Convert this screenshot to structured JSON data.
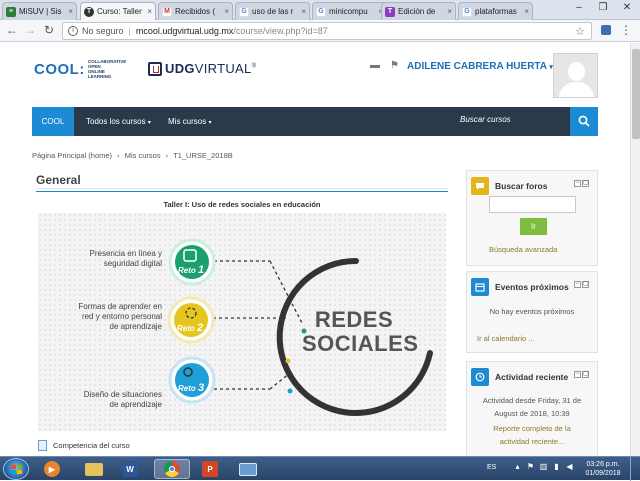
{
  "browser": {
    "tabs": [
      {
        "title": "MiSUV | Sis",
        "icon": "siiau-icon",
        "color": "#2f7a3d",
        "glyph": "≡"
      },
      {
        "title": "Curso: Taller",
        "icon": "moodle-icon",
        "color": "#333333",
        "glyph": "T",
        "active": true
      },
      {
        "title": "Recibidos (",
        "icon": "gmail-icon",
        "color": "#d93025",
        "glyph": "M"
      },
      {
        "title": "uso de las r",
        "icon": "google-icon",
        "color": "#4285f4",
        "glyph": "G"
      },
      {
        "title": "minicompu",
        "icon": "google-icon",
        "color": "#4285f4",
        "glyph": "G"
      },
      {
        "title": "Edición de",
        "icon": "tab-t-icon",
        "color": "#8b3fbd",
        "glyph": "T"
      },
      {
        "title": "plataformas",
        "icon": "google-icon",
        "color": "#4285f4",
        "glyph": "G"
      }
    ],
    "tab_close": "×",
    "window_buttons": {
      "minimize": "–",
      "maximize": "❐",
      "close": "✕"
    },
    "nav": {
      "back": "←",
      "forward": "→",
      "reload": "↻"
    },
    "address": {
      "security_label": "No seguro",
      "host": "mcool.udgvirtual.udg.mx",
      "path": "/course/view.php?id=87"
    },
    "star": "☆",
    "menu": "⋮"
  },
  "header": {
    "cool_logo_big": "COOL:",
    "cool_logo_small": [
      "COLLABORATIVE",
      "OPEN",
      "ONLINE",
      "LEARNING"
    ],
    "udg_logo_bold": "UDG",
    "udg_logo_light": "VIRTUAL",
    "udg_logo_mark": "®",
    "username": "ADILENE CABRERA HUERTA",
    "user_menu_arrow": "▾"
  },
  "navbar": {
    "home": "COOL",
    "items": [
      {
        "label": "Todos los cursos",
        "caret": "▾"
      },
      {
        "label": "Mis cursos",
        "caret": "▾"
      }
    ],
    "search_placeholder": "Buscar cursos",
    "search_glyph": "⌕"
  },
  "breadcrumb": [
    "Página Principal (home)",
    "Mis cursos",
    "T1_URSE_2018B"
  ],
  "breadcrumb_sep": "›",
  "main": {
    "section_title": "General",
    "banner_caption": "Taller I: Uso de redes sociales en educación",
    "banner": {
      "center_lines": [
        "REDES",
        "SOCIALES"
      ],
      "retos": [
        {
          "lines": [
            "Presencia en línea y",
            "seguridad digital"
          ],
          "badge": "Reto",
          "num": "1",
          "color": "#1aa06d",
          "ring": "#d9f1e6"
        },
        {
          "lines": [
            "Formas de aprender en",
            "red y entorno personal",
            "de aprendizaje"
          ],
          "badge": "Reto",
          "num": "2",
          "color": "#e6c51e",
          "ring": "#fbf3c6"
        },
        {
          "lines": [
            "Diseño de situaciones",
            "de aprendizaje"
          ],
          "badge": "Reto",
          "num": "3",
          "color": "#1e9fd8",
          "ring": "#d4ecf8"
        }
      ]
    },
    "resource": "Competencia del curso"
  },
  "blocks": {
    "search": {
      "title": "Buscar foros",
      "button": "Ir",
      "advanced": "Búsqueda avanzada",
      "color": "#e3b51b",
      "link_color": "#8a7a2a"
    },
    "events": {
      "title": "Eventos próximos",
      "empty": "No hay eventos próximos",
      "calendar_link": "Ir al calendario ...",
      "color": "#1d8ad4"
    },
    "activity": {
      "title": "Actividad reciente",
      "since_lines": [
        "Actividad desde Friday, 31 de",
        "August de 2018, 10:39"
      ],
      "report_lines": [
        "Reporte completo de la",
        "actividad reciente..."
      ],
      "color": "#1d8ad4"
    },
    "controls": [
      "−",
      "▢"
    ]
  },
  "taskbar": {
    "lang": "ES",
    "time": "03:26 p.m.",
    "date": "01/09/2018",
    "apps": [
      {
        "name": "media-player-icon",
        "color": "#e8842c",
        "glyph": "▶"
      },
      {
        "name": "file-explorer-icon",
        "color": "#e7c15a",
        "glyph": ""
      },
      {
        "name": "word-icon",
        "color": "#2b5797",
        "glyph": "W"
      },
      {
        "name": "chrome-icon",
        "color": "#dd4b39",
        "glyph": "",
        "active": true
      },
      {
        "name": "powerpoint-icon",
        "color": "#d24726",
        "glyph": "P"
      },
      {
        "name": "photos-icon",
        "color": "#6a9bd1",
        "glyph": ""
      }
    ]
  }
}
